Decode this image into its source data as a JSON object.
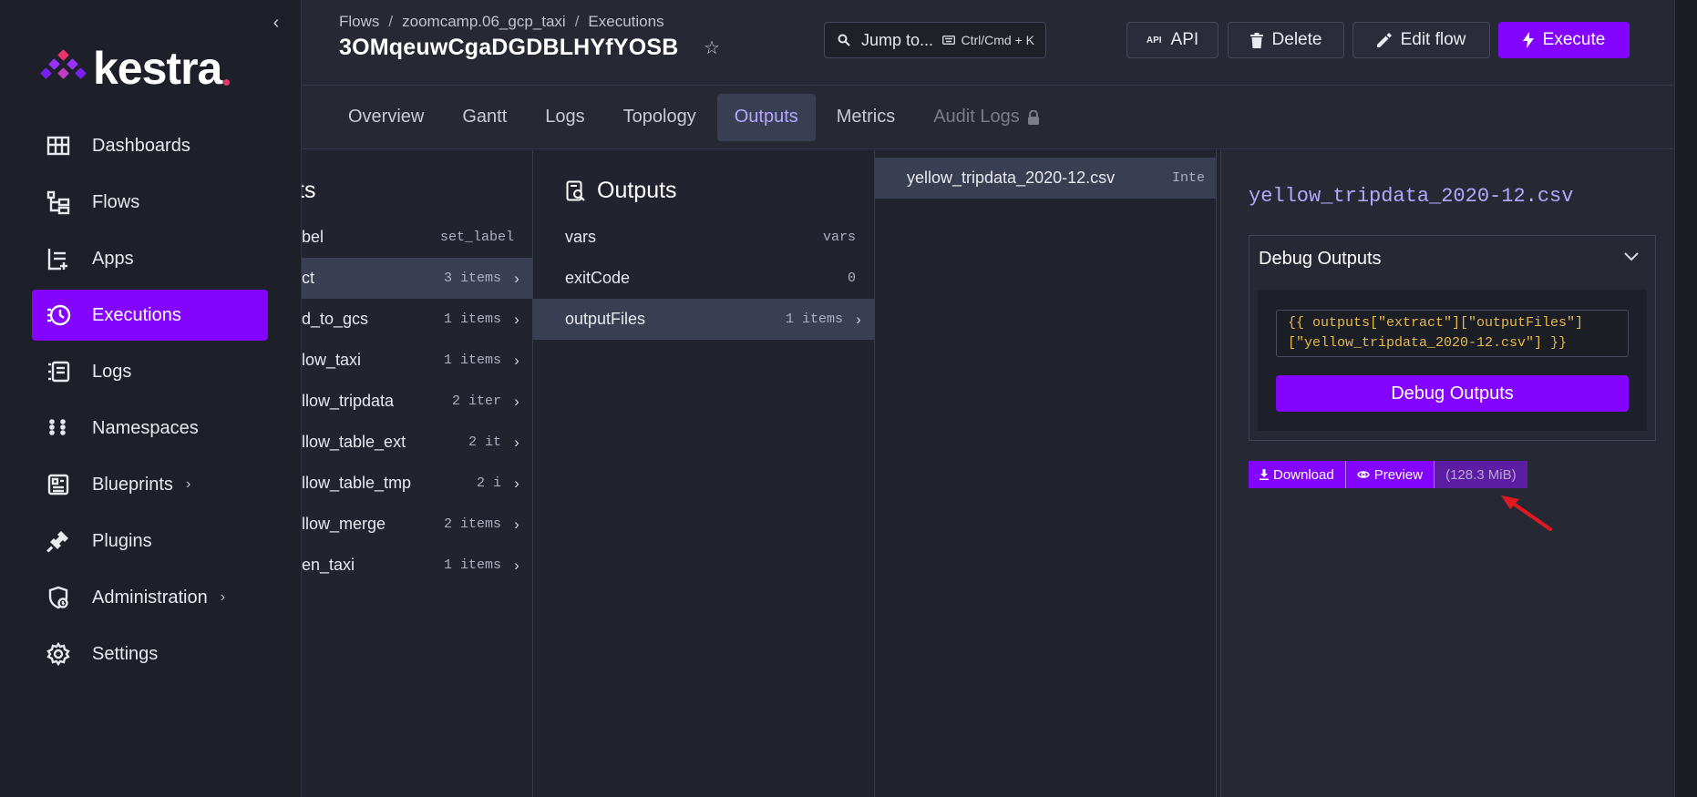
{
  "sidebar": {
    "collapse_icon": "chevron-left-icon",
    "logo_text": "kestra",
    "items": [
      {
        "label": "Dashboards",
        "icon": "dashboard-icon"
      },
      {
        "label": "Flows",
        "icon": "flows-icon"
      },
      {
        "label": "Apps",
        "icon": "apps-icon"
      },
      {
        "label": "Executions",
        "icon": "executions-icon",
        "active": true
      },
      {
        "label": "Logs",
        "icon": "logs-icon"
      },
      {
        "label": "Namespaces",
        "icon": "namespaces-icon"
      },
      {
        "label": "Blueprints",
        "icon": "blueprints-icon",
        "chevron": "›"
      },
      {
        "label": "Plugins",
        "icon": "plugins-icon"
      },
      {
        "label": "Administration",
        "icon": "administration-icon",
        "chevron": "›"
      },
      {
        "label": "Settings",
        "icon": "settings-icon"
      }
    ]
  },
  "header": {
    "breadcrumb": [
      "Flows",
      "zoomcamp.06_gcp_taxi",
      "Executions"
    ],
    "breadcrumb_sep": "/",
    "execution_id": "3OMqeuwCgaDGDBLHYfYOSB",
    "star": "☆",
    "jump_label": "Jump to...",
    "jump_shortcut": "Ctrl/Cmd + K",
    "api_label": "API",
    "delete_label": "Delete",
    "edit_label": "Edit flow",
    "execute_label": "Execute"
  },
  "tabs": [
    {
      "label": "Overview"
    },
    {
      "label": "Gantt"
    },
    {
      "label": "Logs"
    },
    {
      "label": "Topology"
    },
    {
      "label": "Outputs",
      "active": true
    },
    {
      "label": "Metrics"
    },
    {
      "label": "Audit Logs",
      "disabled": true,
      "lock": "🔒"
    }
  ],
  "tasks_column": {
    "title_fragment": "ts",
    "rows": [
      {
        "label": "bel",
        "meta": "set_label",
        "chev": ""
      },
      {
        "label": "ct",
        "meta": "3 items",
        "chev": "›",
        "selected": true
      },
      {
        "label": "d_to_gcs",
        "meta": "1 items",
        "chev": "›"
      },
      {
        "label": "low_taxi",
        "meta": "1 items",
        "chev": "›"
      },
      {
        "label": "llow_tripdata",
        "meta": "2 iter",
        "chev": "›"
      },
      {
        "label": "llow_table_ext",
        "meta": "2 it",
        "chev": "›"
      },
      {
        "label": "llow_table_tmp",
        "meta": "2 i",
        "chev": "›"
      },
      {
        "label": "llow_merge",
        "meta": "2 items",
        "chev": "›"
      },
      {
        "label": "en_taxi",
        "meta": "1 items",
        "chev": "›"
      }
    ]
  },
  "outputs_column": {
    "title": "Outputs",
    "rows": [
      {
        "label": "vars",
        "meta": "vars",
        "chev": ""
      },
      {
        "label": "exitCode",
        "meta": "0",
        "chev": ""
      },
      {
        "label": "outputFiles",
        "meta": "1 items",
        "chev": "›",
        "selected": true
      }
    ]
  },
  "files_column": {
    "rows": [
      {
        "label": "yellow_tripdata_2020-12.csv",
        "meta": "Inte",
        "selected": true
      }
    ]
  },
  "detail": {
    "file_title": "yellow_tripdata_2020-12.csv",
    "debug_header": "Debug Outputs",
    "debug_code": "{{ outputs[\"extract\"][\"outputFiles\"]\n[\"yellow_tripdata_2020-12.csv\"] }}",
    "debug_button": "Debug Outputs",
    "download_label": "Download",
    "preview_label": "Preview",
    "size_label": "(128.3 MiB)"
  },
  "colors": {
    "accent": "#8405ff",
    "sidebar_bg": "#1e2029",
    "panel_bg": "#262834",
    "selected_tab_text": "#b7a7ff",
    "code_text": "#e7b949",
    "annotation_arrow": "#e0191f"
  }
}
